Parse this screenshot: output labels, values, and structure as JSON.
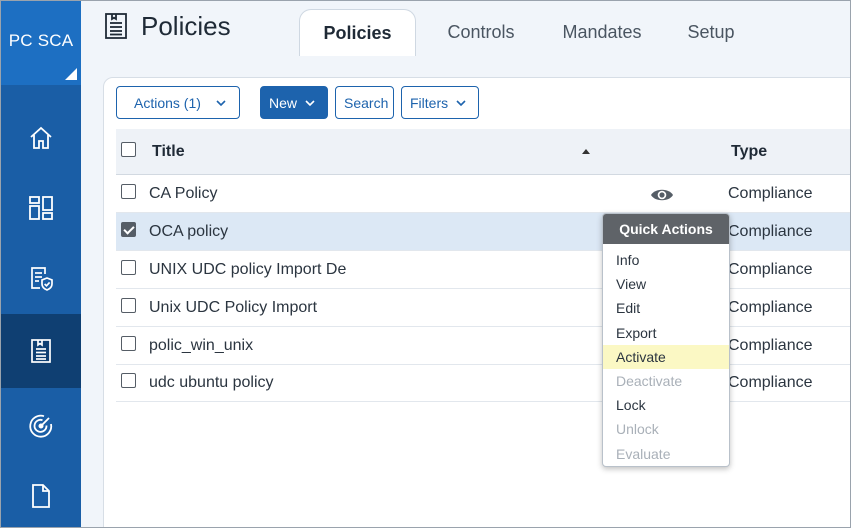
{
  "sidebar": {
    "brand": "PC SCA",
    "items": [
      {
        "icon": "home-icon"
      },
      {
        "icon": "dashboard-icon"
      },
      {
        "icon": "compliance-report-icon"
      },
      {
        "icon": "policy-document-icon",
        "active": true
      },
      {
        "icon": "scan-radar-icon"
      },
      {
        "icon": "file-icon"
      }
    ]
  },
  "header": {
    "title": "Policies",
    "tabs": [
      {
        "label": "Policies",
        "active": true
      },
      {
        "label": "Controls"
      },
      {
        "label": "Mandates"
      },
      {
        "label": "Setup"
      }
    ]
  },
  "toolbar": {
    "actions_label": "Actions (1)",
    "new_label": "New",
    "search_label": "Search",
    "filters_label": "Filters"
  },
  "table": {
    "columns": [
      "Title",
      "Type"
    ],
    "rows": [
      {
        "title": "CA Policy",
        "type": "Compliance",
        "checked": false
      },
      {
        "title": "OCA policy",
        "type": "Compliance",
        "checked": true
      },
      {
        "title": "UNIX UDC policy Import De",
        "type": "Compliance",
        "checked": false
      },
      {
        "title": "Unix UDC Policy Import",
        "type": "Compliance",
        "checked": false
      },
      {
        "title": "polic_win_unix",
        "type": "Compliance",
        "checked": false
      },
      {
        "title": "udc ubuntu policy",
        "type": "Compliance",
        "checked": false
      }
    ]
  },
  "quick_actions": {
    "title": "Quick Actions",
    "items": [
      {
        "label": "Info",
        "state": "enabled"
      },
      {
        "label": "View",
        "state": "enabled"
      },
      {
        "label": "Edit",
        "state": "enabled"
      },
      {
        "label": "Export",
        "state": "enabled"
      },
      {
        "label": "Activate",
        "state": "hover"
      },
      {
        "label": "Deactivate",
        "state": "disabled"
      },
      {
        "label": "Lock",
        "state": "enabled"
      },
      {
        "label": "Unlock",
        "state": "disabled"
      },
      {
        "label": "Evaluate",
        "state": "disabled"
      }
    ]
  },
  "colors": {
    "sidebar": "#1a5ea6",
    "sidebar_active": "#0f3f72",
    "brand": "#1d6fc2",
    "primary_button": "#1d63ad",
    "selected_row": "#dce8f5",
    "menu_header": "#5f6368",
    "menu_hover": "#fbf8c4"
  }
}
